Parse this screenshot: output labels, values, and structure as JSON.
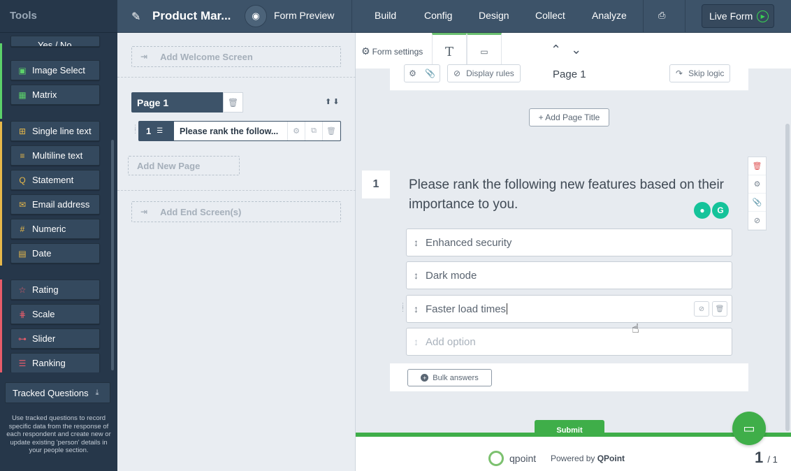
{
  "tools": {
    "header": "Tools",
    "partial_item": "Yes / No",
    "items": [
      {
        "label": "Image Select",
        "icon": "image-icon",
        "glyph": "▣",
        "color": "#5cd16a"
      },
      {
        "label": "Matrix",
        "icon": "matrix-icon",
        "glyph": "▦",
        "color": "#5cd16a"
      },
      {
        "label": "Single line text",
        "icon": "single-line-icon",
        "glyph": "⊞",
        "color": "#e7b84a"
      },
      {
        "label": "Multiline text",
        "icon": "multiline-icon",
        "glyph": "≡",
        "color": "#e7b84a"
      },
      {
        "label": "Statement",
        "icon": "statement-icon",
        "glyph": "Q",
        "color": "#e7b84a"
      },
      {
        "label": "Email address",
        "icon": "email-icon",
        "glyph": "✉",
        "color": "#e7b84a"
      },
      {
        "label": "Numeric",
        "icon": "numeric-icon",
        "glyph": "#",
        "color": "#e7b84a"
      },
      {
        "label": "Date",
        "icon": "date-icon",
        "glyph": "▤",
        "color": "#e7b84a"
      },
      {
        "label": "Rating",
        "icon": "star-icon",
        "glyph": "☆",
        "color": "#e85c6a"
      },
      {
        "label": "Scale",
        "icon": "scale-icon",
        "glyph": "⋕",
        "color": "#e85c6a"
      },
      {
        "label": "Slider",
        "icon": "slider-icon",
        "glyph": "⊶",
        "color": "#e85c6a"
      },
      {
        "label": "Ranking",
        "icon": "ranking-icon",
        "glyph": "☰",
        "color": "#e85c6a"
      }
    ],
    "tracked_label": "Tracked Questions",
    "tracked_desc": "Use tracked questions to record specific data from the response of each respondent and create new or update existing 'person' details in your people section."
  },
  "topbar": {
    "title": "Product Mar...",
    "preview": "Form Preview",
    "tabs": [
      "Build",
      "Config",
      "Design",
      "Collect",
      "Analyze"
    ],
    "live": "Live Form"
  },
  "structure": {
    "welcome": "Add Welcome Screen",
    "page_label": "Page 1",
    "question_number": "1",
    "question_text": "Please rank the follow...",
    "new_page": "Add New Page",
    "end_screen": "Add End Screen(s)"
  },
  "canvas": {
    "form_settings": "Form settings",
    "display_rules": "Display rules",
    "page_label": "Page 1",
    "skip_logic": "Skip logic",
    "add_page_title": "+ Add Page Title",
    "question_number": "1",
    "question_title": "Please rank the following new features based on their importance to you.",
    "options": [
      "Enhanced security",
      "Dark mode",
      "Faster load times"
    ],
    "add_option_placeholder": "Add option",
    "bulk_answers": "Bulk answers",
    "submit": "Submit",
    "footer_brand": "qpoint",
    "powered_by": "Powered by",
    "powered_brand": "QPoint",
    "page_current": "1",
    "page_total": "/ 1"
  }
}
